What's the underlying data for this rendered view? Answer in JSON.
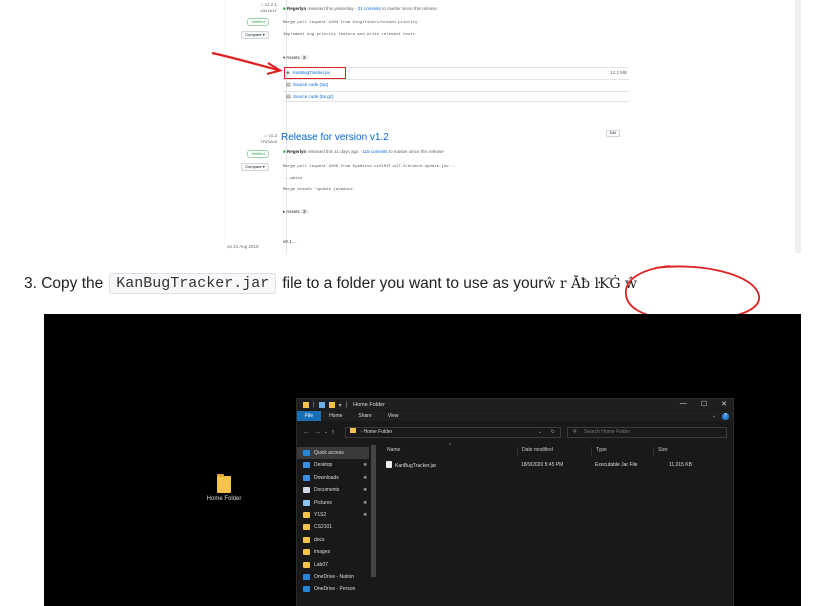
{
  "release_page": {
    "v121": {
      "tag": "v1.2.1",
      "commit": "d3c1b1f",
      "verified": "Verified",
      "compare": "Compare ▾",
      "author": "Regerlyn",
      "released_text": "released this yesterday",
      "commits_link": "21 commits",
      "commits_suffix": "to master since this release",
      "notes": [
        "Merge pull request #184 from Kingfishers/branch-priority",
        "Implement bug priority feature and write relevant tests"
      ],
      "assets_label": "Assets",
      "assets_count": "3",
      "assets": [
        {
          "icon": "package-icon",
          "name": "KanBugTracker.jar",
          "size": "12.2 MB"
        },
        {
          "icon": "file-zip-icon",
          "name": "Source code (zip)",
          "size": ""
        },
        {
          "icon": "file-zip-icon",
          "name": "Source code (tar.gz)",
          "size": ""
        }
      ]
    },
    "v12": {
      "tag": "v1.2",
      "commit": "7f932d4",
      "verified": "Verified",
      "compare": "Compare ▾",
      "title": "Release for version v1.2",
      "badge": "Edit",
      "author": "Regerlyn",
      "released_text": "released this 11 days ago",
      "commits_link": "119 commits",
      "commits_suffix": "to master since this release",
      "notes": [
        "Merge pull request #209 from Kyabsiss-cs2103T-w17-3/branch-update-jav...",
        "...wbiss",
        "Merge branch 'update javadocs'"
      ],
      "assets_label": "Assets",
      "assets_count": "3"
    },
    "v01": {
      "date": "on 21 Aug 2019",
      "tag": "v0.1",
      "badge": "..."
    }
  },
  "instruction": {
    "prefix": "3. Copy the",
    "code": "KanBugTracker.jar",
    "suffix": "file to a folder you want to use as your",
    "garbled": "ŵ r Ăƀ ŀƘĠ ŵ"
  },
  "desktop": {
    "icon_label": "Home Folder"
  },
  "explorer": {
    "title": "Home Folder",
    "ribbon_tabs": [
      "File",
      "Home",
      "Share",
      "View"
    ],
    "address": "Home Folder",
    "search_placeholder": "Search Home Folder",
    "nav_items": [
      {
        "label": "Quick access",
        "icon_color": "#2a84d9",
        "pinned": false,
        "selected": true
      },
      {
        "label": "Desktop",
        "icon_color": "#3b8fe0",
        "pinned": true
      },
      {
        "label": "Downloads",
        "icon_color": "#3b8fe0",
        "pinned": true
      },
      {
        "label": "Documents",
        "icon_color": "#cfd8e3",
        "pinned": true
      },
      {
        "label": "Pictures",
        "icon_color": "#8fc4f0",
        "pinned": true
      },
      {
        "label": "Y1S2",
        "icon_color": "#f4c34b",
        "pinned": true
      },
      {
        "label": "CS2101",
        "icon_color": "#f4c34b",
        "pinned": false
      },
      {
        "label": "docs",
        "icon_color": "#f4c34b",
        "pinned": false
      },
      {
        "label": "images",
        "icon_color": "#f4c34b",
        "pinned": false
      },
      {
        "label": "Lab07",
        "icon_color": "#f4c34b",
        "pinned": false
      },
      {
        "label": "OneDrive - Nation",
        "icon_color": "#2a84d9",
        "pinned": false
      },
      {
        "label": "OneDrive - Person",
        "icon_color": "#2a84d9",
        "pinned": false
      }
    ],
    "columns": [
      "Name",
      "Date modified",
      "Type",
      "Size"
    ],
    "files": [
      {
        "name": "KanBugTracker.jar",
        "date": "18/9/2020 5:45 PM",
        "type": "Executable Jar File",
        "size": "11,015 KB"
      }
    ]
  }
}
